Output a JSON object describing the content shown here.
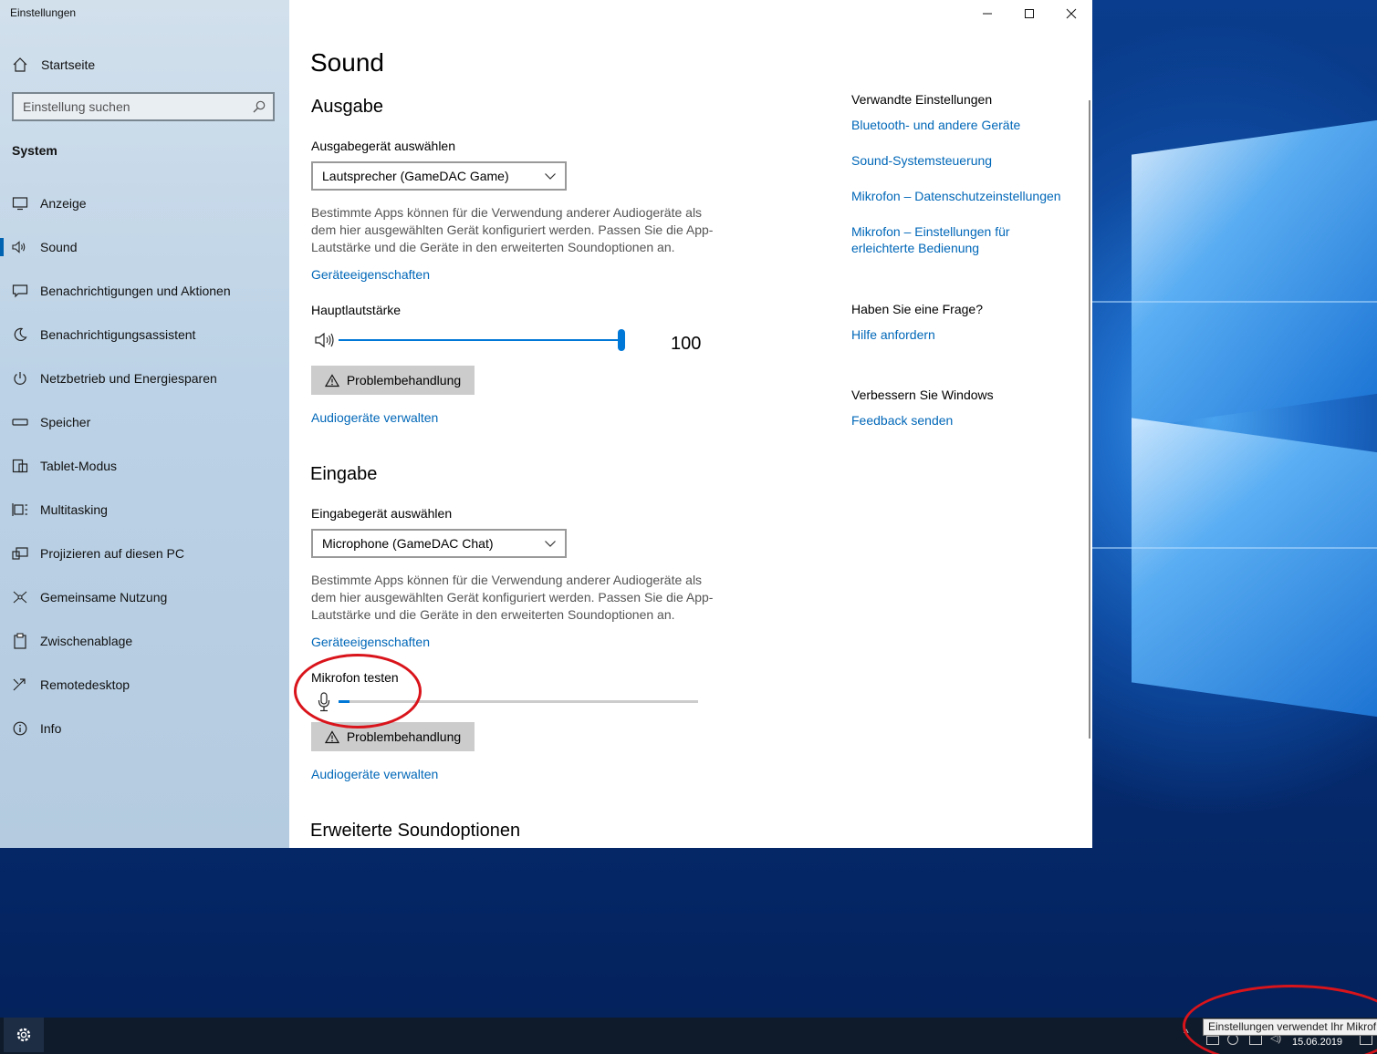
{
  "window": {
    "title": "Einstellungen"
  },
  "sidebar": {
    "home_label": "Startseite",
    "search_placeholder": "Einstellung suchen",
    "section": "System",
    "items": [
      {
        "label": "Anzeige",
        "icon": "monitor-icon"
      },
      {
        "label": "Sound",
        "icon": "speaker-icon",
        "active": true
      },
      {
        "label": "Benachrichtigungen und Aktionen",
        "icon": "notification-icon"
      },
      {
        "label": "Benachrichtigungsassistent",
        "icon": "moon-icon"
      },
      {
        "label": "Netzbetrieb und Energiesparen",
        "icon": "power-icon"
      },
      {
        "label": "Speicher",
        "icon": "storage-icon"
      },
      {
        "label": "Tablet-Modus",
        "icon": "tablet-icon"
      },
      {
        "label": "Multitasking",
        "icon": "multitasking-icon"
      },
      {
        "label": "Projizieren auf diesen PC",
        "icon": "project-icon"
      },
      {
        "label": "Gemeinsame Nutzung",
        "icon": "share-icon"
      },
      {
        "label": "Zwischenablage",
        "icon": "clipboard-icon"
      },
      {
        "label": "Remotedesktop",
        "icon": "remote-icon"
      },
      {
        "label": "Info",
        "icon": "info-icon"
      }
    ]
  },
  "main": {
    "title": "Sound",
    "output": {
      "heading": "Ausgabe",
      "device_label": "Ausgabegerät auswählen",
      "device_value": "Lautsprecher (GameDAC Game)",
      "description": "Bestimmte Apps können für die Verwendung anderer Audiogeräte als dem hier ausgewählten Gerät konfiguriert werden. Passen Sie die App-Lautstärke und die Geräte in den erweiterten Soundoptionen an.",
      "properties_link": "Geräteeigenschaften",
      "volume_label": "Hauptlautstärke",
      "volume_value": "100",
      "troubleshoot_label": "Problembehandlung",
      "manage_link": "Audiogeräte verwalten"
    },
    "input": {
      "heading": "Eingabe",
      "device_label": "Eingabegerät auswählen",
      "device_value": "Microphone (GameDAC Chat)",
      "description": "Bestimmte Apps können für die Verwendung anderer Audiogeräte als dem hier ausgewählten Gerät konfiguriert werden. Passen Sie die App-Lautstärke und die Geräte in den erweiterten Soundoptionen an.",
      "properties_link": "Geräteeigenschaften",
      "test_label": "Mikrofon testen",
      "mic_level": 0.03,
      "troubleshoot_label": "Problembehandlung",
      "manage_link": "Audiogeräte verwalten"
    },
    "advanced_heading": "Erweiterte Soundoptionen"
  },
  "related": {
    "heading": "Verwandte Einstellungen",
    "links": [
      "Bluetooth- und andere Geräte",
      "Sound-Systemsteuerung",
      "Mikrofon – Datenschutzeinstellungen",
      "Mikrofon – Einstellungen für erleichterte Bedienung"
    ],
    "question_heading": "Haben Sie eine Frage?",
    "help_link": "Hilfe anfordern",
    "improve_heading": "Verbessern Sie Windows",
    "feedback_link": "Feedback senden"
  },
  "taskbar": {
    "tooltip": "Einstellungen verwendet Ihr Mikrof",
    "date": "15.06.2019"
  },
  "colors": {
    "accent": "#0078d7",
    "link": "#0067b8",
    "annotation": "#d9141b"
  }
}
